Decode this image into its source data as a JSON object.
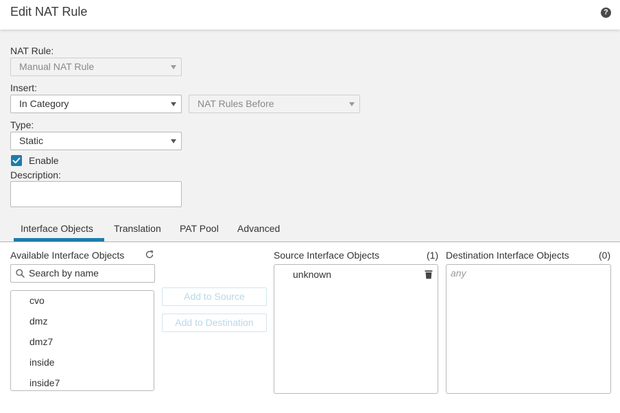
{
  "header": {
    "title": "Edit NAT Rule",
    "help_icon": "question-circle-icon"
  },
  "form": {
    "nat_rule": {
      "label": "NAT Rule:",
      "value": "Manual NAT Rule",
      "disabled": true
    },
    "insert": {
      "label": "Insert:",
      "value": "In Category",
      "secondary_value": "NAT Rules Before",
      "secondary_disabled": true
    },
    "type": {
      "label": "Type:",
      "value": "Static"
    },
    "enable": {
      "label": "Enable",
      "checked": true
    },
    "description": {
      "label": "Description:",
      "value": ""
    }
  },
  "tabs": [
    {
      "label": "Interface Objects",
      "active": true
    },
    {
      "label": "Translation",
      "active": false
    },
    {
      "label": "PAT Pool",
      "active": false
    },
    {
      "label": "Advanced",
      "active": false
    }
  ],
  "interface_objects": {
    "available": {
      "title": "Available Interface Objects",
      "refresh_icon": "refresh-icon",
      "search_placeholder": "Search by name",
      "items": [
        "cvo",
        "dmz",
        "dmz7",
        "inside",
        "inside7"
      ]
    },
    "buttons": {
      "add_to_source": "Add to Source",
      "add_to_destination": "Add to Destination"
    },
    "source": {
      "title": "Source Interface Objects",
      "count": "(1)",
      "items": [
        "unknown"
      ]
    },
    "destination": {
      "title": "Destination Interface Objects",
      "count": "(0)",
      "placeholder": "any",
      "items": []
    }
  },
  "colors": {
    "accent": "#1e7bab",
    "form_background": "#f2f2f2",
    "disabled_button_text": "#b8d8e8"
  }
}
